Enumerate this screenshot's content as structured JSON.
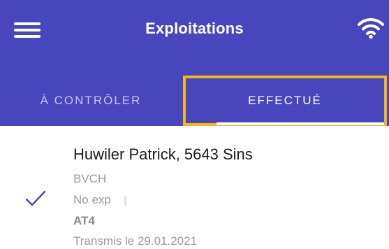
{
  "header": {
    "title": "Exploitations",
    "colors": {
      "primary": "#4846bd",
      "highlight": "#f5b614"
    }
  },
  "tabs": [
    {
      "label": "À CONTRÔLER",
      "selected": false
    },
    {
      "label": "EFFECTUÉ",
      "selected": true
    }
  ],
  "list": {
    "items": [
      {
        "title": "Huwiler Patrick, 5643 Sins",
        "org": "BVCH",
        "exp": "No exp",
        "code": "AT4",
        "date": "Transmis le 29.01.2021",
        "status_icon": "check-icon"
      }
    ]
  }
}
